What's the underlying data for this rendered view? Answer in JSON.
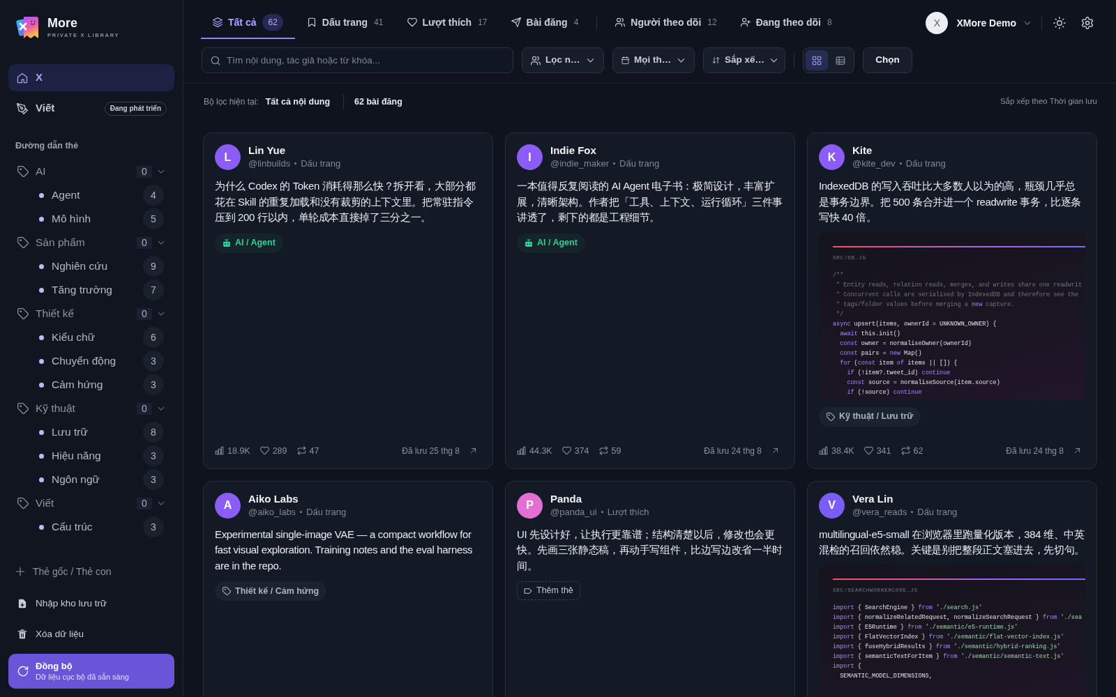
{
  "app": {
    "name": "More",
    "tagline": "PRIVATE X LIBRARY"
  },
  "nav": [
    {
      "label": "X",
      "selected": true
    },
    {
      "label": "Viết",
      "selected": false,
      "badge": "Đang phát triển"
    }
  ],
  "tag_tree": {
    "title": "Đường dẫn thẻ",
    "items": [
      {
        "label": "AI",
        "count": "0",
        "expanded": true,
        "children": [
          {
            "label": "Agent",
            "count": "4"
          },
          {
            "label": "Mô hình",
            "count": "5"
          }
        ]
      },
      {
        "label": "Sản phẩm",
        "count": "0",
        "expanded": true,
        "children": [
          {
            "label": "Nghiên cứu",
            "count": "9"
          },
          {
            "label": "Tăng trưởng",
            "count": "7"
          }
        ]
      },
      {
        "label": "Thiết kế",
        "count": "0",
        "expanded": true,
        "children": [
          {
            "label": "Kiểu chữ",
            "count": "6"
          },
          {
            "label": "Chuyển động",
            "count": "3"
          },
          {
            "label": "Cảm hứng",
            "count": "3"
          }
        ]
      },
      {
        "label": "Kỹ thuật",
        "count": "0",
        "expanded": true,
        "children": [
          {
            "label": "Lưu trữ",
            "count": "8"
          },
          {
            "label": "Hiệu năng",
            "count": "3"
          },
          {
            "label": "Ngôn ngữ",
            "count": "3"
          }
        ]
      },
      {
        "label": "Viết",
        "count": "0",
        "expanded": true,
        "children": [
          {
            "label": "Cấu trúc",
            "count": "3"
          }
        ]
      }
    ]
  },
  "add_tag": "Thẻ gốc / Thẻ con",
  "actions": [
    "Nhập kho lưu trữ",
    "Xóa dữ liệu"
  ],
  "sync": {
    "title": "Đồng bộ",
    "status": "Dữ liệu cục bộ đã sẵn sàng"
  },
  "tabs": [
    {
      "label": "Tất cả",
      "count": "62",
      "selected": true
    },
    {
      "label": "Dấu trang",
      "count": "41",
      "selected": false
    },
    {
      "label": "Lượt thích",
      "count": "17",
      "selected": false
    },
    {
      "label": "Bài đăng",
      "count": "4",
      "selected": false
    }
  ],
  "people_tabs": [
    {
      "label": "Người theo dõi",
      "count": "12",
      "selected": false
    },
    {
      "label": "Đang theo dõi",
      "count": "8",
      "selected": false
    }
  ],
  "account": {
    "initial": "X",
    "name": "XMore Demo"
  },
  "search": {
    "placeholder": "Tìm nội dung, tác giả hoặc từ khóa..."
  },
  "filters": [
    "Lọc n…",
    "Mọi th…",
    "Sắp xế…"
  ],
  "view_modes": [
    {
      "selected": true
    },
    {
      "selected": false
    }
  ],
  "select_button": "Chọn",
  "filter_summary": {
    "label": "Bộ lọc hiện tại:",
    "value": "Tất cả nội dung",
    "count": "62 bài đăng",
    "sort": "Sắp xếp theo Thời gian lưu"
  },
  "posts": [
    {
      "initial": "L",
      "color": "#8b5cf6",
      "name": "Lin Yue",
      "handle": "@linbuilds",
      "source": "Dấu trang",
      "text": "为什么 Codex 的 Token 消耗得那么快？拆开看，大部分都花在 Skill 的重复加载和没有裁剪的上下文里。把常驻指令压到 200 行以内，单轮成本直接掉了三分之一。",
      "tag": {
        "kind": "ai",
        "label": "AI / Agent"
      },
      "stats": {
        "views": "18.9K",
        "likes": "289",
        "reposts": "47"
      },
      "saved": "Đã lưu 25 thg 8"
    },
    {
      "initial": "I",
      "color": "#8b5cf6",
      "name": "Indie Fox",
      "handle": "@indie_maker",
      "source": "Dấu trang",
      "text": "一本值得反复阅读的 AI Agent 电子书：极简设计，丰富扩展，清晰架构。作者把「工具、上下文、运行循环」三件事讲透了，剩下的都是工程细节。",
      "tag": {
        "kind": "ai",
        "label": "AI / Agent"
      },
      "stats": {
        "views": "44.3K",
        "likes": "374",
        "reposts": "59"
      },
      "saved": "Đã lưu 24 thg 8"
    },
    {
      "initial": "K",
      "color": "#8b5cf6",
      "name": "Kite",
      "handle": "@kite_dev",
      "source": "Dấu trang",
      "text": "IndexedDB 的写入吞吐比大多数人以为的高，瓶颈几乎总是事务边界。把 500 条合并进一个 readwrite 事务，比逐条写快 40 倍。",
      "code": {
        "file": "SRC/DB.JS",
        "lines": [
          [
            {
              "text": "/**",
              "kind": "comment"
            }
          ],
          [
            {
              "text": " * Entity reads, relation reads, merges, and writes share one readwrit",
              "kind": "comment"
            }
          ],
          [
            {
              "text": " * Concurrent calls are serialised by IndexedDB and therefore see the",
              "kind": "comment"
            }
          ],
          [
            {
              "text": " * tags/folder values before merging a ",
              "kind": "comment"
            },
            {
              "text": "new",
              "kind": "keyword"
            },
            {
              "text": " capture.",
              "kind": "comment"
            }
          ],
          [
            {
              "text": " */",
              "kind": "comment"
            }
          ],
          [
            {
              "text": "async",
              "kind": "keyword"
            },
            {
              "text": " upsert(items, ownerId = UNKNOWN_OWNER) {",
              "kind": "plain"
            }
          ],
          [
            {
              "text": "  await",
              "kind": "keyword"
            },
            {
              "text": " this.init()",
              "kind": "plain"
            }
          ],
          [
            {
              "text": "  const",
              "kind": "keyword"
            },
            {
              "text": " owner = normaliseOwner(ownerId)",
              "kind": "plain"
            }
          ],
          [
            {
              "text": "  const",
              "kind": "keyword"
            },
            {
              "text": " pairs = ",
              "kind": "plain"
            },
            {
              "text": "new",
              "kind": "keyword"
            },
            {
              "text": " Map()",
              "kind": "plain"
            }
          ],
          [
            {
              "text": "  for",
              "kind": "keyword"
            },
            {
              "text": " (",
              "kind": "plain"
            },
            {
              "text": "const",
              "kind": "keyword"
            },
            {
              "text": " item ",
              "kind": "plain"
            },
            {
              "text": "of",
              "kind": "keyword"
            },
            {
              "text": " items || []) {",
              "kind": "plain"
            }
          ],
          [
            {
              "text": "    if",
              "kind": "keyword"
            },
            {
              "text": " (!item?.tweet_id) ",
              "kind": "plain"
            },
            {
              "text": "continue",
              "kind": "keyword"
            }
          ],
          [
            {
              "text": "    const",
              "kind": "keyword"
            },
            {
              "text": " source = normaliseSource(item.source)",
              "kind": "plain"
            }
          ],
          [
            {
              "text": "    if",
              "kind": "keyword"
            },
            {
              "text": " (!source) ",
              "kind": "plain"
            },
            {
              "text": "continue",
              "kind": "keyword"
            }
          ]
        ]
      },
      "tag": {
        "kind": "plain",
        "label": "Kỹ thuật / Lưu trữ"
      },
      "stats": {
        "views": "38.4K",
        "likes": "341",
        "reposts": "62"
      },
      "saved": "Đã lưu 24 thg 8"
    },
    {
      "initial": "A",
      "color": "#8b5cf6",
      "name": "Aiko Labs",
      "handle": "@aiko_labs",
      "source": "Dấu trang",
      "text": "Experimental single-image VAE — a compact workflow for fast visual exploration. Training notes and the eval harness are in the repo.",
      "tag": {
        "kind": "plain",
        "label": "Thiết kế / Cảm hứng"
      }
    },
    {
      "initial": "P",
      "color": "#e46fd2",
      "name": "Panda",
      "handle": "@panda_ui",
      "source": "Lượt thích",
      "text": "UI 先设计好，让执行更靠谱；结构清楚以后，修改也会更快。先画三张静态稿，再动手写组件，比边写边改省一半时间。",
      "tag": {
        "kind": "add",
        "label": "Thêm thẻ"
      }
    },
    {
      "initial": "V",
      "color": "#7c5cf6",
      "name": "Vera Lin",
      "handle": "@vera_reads",
      "source": "Dấu trang",
      "text": "multilingual-e5-small 在浏览器里跑量化版本，384 维、中英混检的召回依然稳。关键是别把整段正文塞进去，先切句。",
      "code": {
        "file": "SRC/SEARCHWORKERCORE.JS",
        "lines": [
          [
            {
              "text": "import",
              "kind": "keyword"
            },
            {
              "text": " { SearchEngine } ",
              "kind": "plain"
            },
            {
              "text": "from",
              "kind": "keyword"
            },
            {
              "text": " './search.js'",
              "kind": "string"
            }
          ],
          [
            {
              "text": "import",
              "kind": "keyword"
            },
            {
              "text": " { normalizeRelatedRequest, normalizeSearchRequest } ",
              "kind": "plain"
            },
            {
              "text": "from",
              "kind": "keyword"
            },
            {
              "text": " './sea",
              "kind": "string"
            }
          ],
          [
            {
              "text": "import",
              "kind": "keyword"
            },
            {
              "text": " { E5Runtime } ",
              "kind": "plain"
            },
            {
              "text": "from",
              "kind": "keyword"
            },
            {
              "text": " './semantic/e5-runtime.js'",
              "kind": "string"
            }
          ],
          [
            {
              "text": "import",
              "kind": "keyword"
            },
            {
              "text": " { FlatVectorIndex } ",
              "kind": "plain"
            },
            {
              "text": "from",
              "kind": "keyword"
            },
            {
              "text": " './semantic/flat-vector-index.js'",
              "kind": "string"
            }
          ],
          [
            {
              "text": "import",
              "kind": "keyword"
            },
            {
              "text": " { fuseHybridResults } ",
              "kind": "plain"
            },
            {
              "text": "from",
              "kind": "keyword"
            },
            {
              "text": " './semantic/hybrid-ranking.js'",
              "kind": "string"
            }
          ],
          [
            {
              "text": "import",
              "kind": "keyword"
            },
            {
              "text": " { semanticTextForItem } ",
              "kind": "plain"
            },
            {
              "text": "from",
              "kind": "keyword"
            },
            {
              "text": " './semantic/semantic-text.js'",
              "kind": "string"
            }
          ],
          [
            {
              "text": "import",
              "kind": "keyword"
            },
            {
              "text": " {",
              "kind": "plain"
            }
          ],
          [
            {
              "text": "  SEMANTIC_MODEL_DIMENSIONS,",
              "kind": "plain"
            }
          ]
        ]
      }
    }
  ]
}
